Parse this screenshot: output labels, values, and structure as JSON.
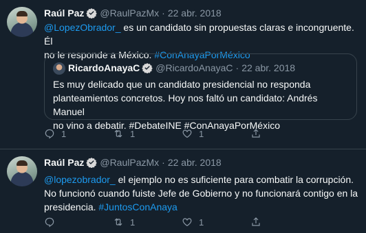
{
  "tweets": [
    {
      "author": {
        "name": "Raúl Paz",
        "handle": "@RaulPazMx",
        "date": "22 abr. 2018"
      },
      "text_parts": {
        "mention": "@LopezObrador_",
        "line1": " es un candidato sin propuestas claras e  incongruente. Él",
        "line2": "no le responde a México. ",
        "hashtag": "#ConAnayaPorMéxico"
      },
      "quote": {
        "name": "RicardoAnayaC",
        "handle": "@RicardoAnayaC",
        "date": "22 abr. 2018",
        "line1": "Es muy delicado que un candidato presidencial no responda",
        "line2": "planteamientos concretos. Hoy nos faltó un candidato: Andrés Manuel",
        "line3": "no vino a debatir. #DebateINE #ConAnayaPorMéxico"
      },
      "actions": {
        "reply_count": "1",
        "retweet_count": "1",
        "like_count": "1"
      }
    },
    {
      "author": {
        "name": "Raúl Paz",
        "handle": "@RaulPazMx",
        "date": "22 abr. 2018"
      },
      "text_parts": {
        "mention": "@lopezobrador_",
        "line1": "  el ejemplo no es suficiente para combatir la corrupción.",
        "line2": "No funcionó cuando fuiste Jefe de Gobierno y no funcionará contigo en la",
        "line3": "presidencia. ",
        "hashtag": "#JuntosConAnaya"
      },
      "actions": {
        "reply_count": "",
        "retweet_count": "1",
        "like_count": "1"
      }
    }
  ],
  "separator": "·",
  "colors": {
    "background": "#15202b",
    "text": "#f7f9f9",
    "muted": "#8b98a5",
    "link": "#1d9bf0",
    "border": "#38444d"
  },
  "icons": {
    "verified": "verified-badge-icon",
    "reply": "reply-icon",
    "retweet": "retweet-icon",
    "like": "heart-icon",
    "share": "share-icon"
  }
}
